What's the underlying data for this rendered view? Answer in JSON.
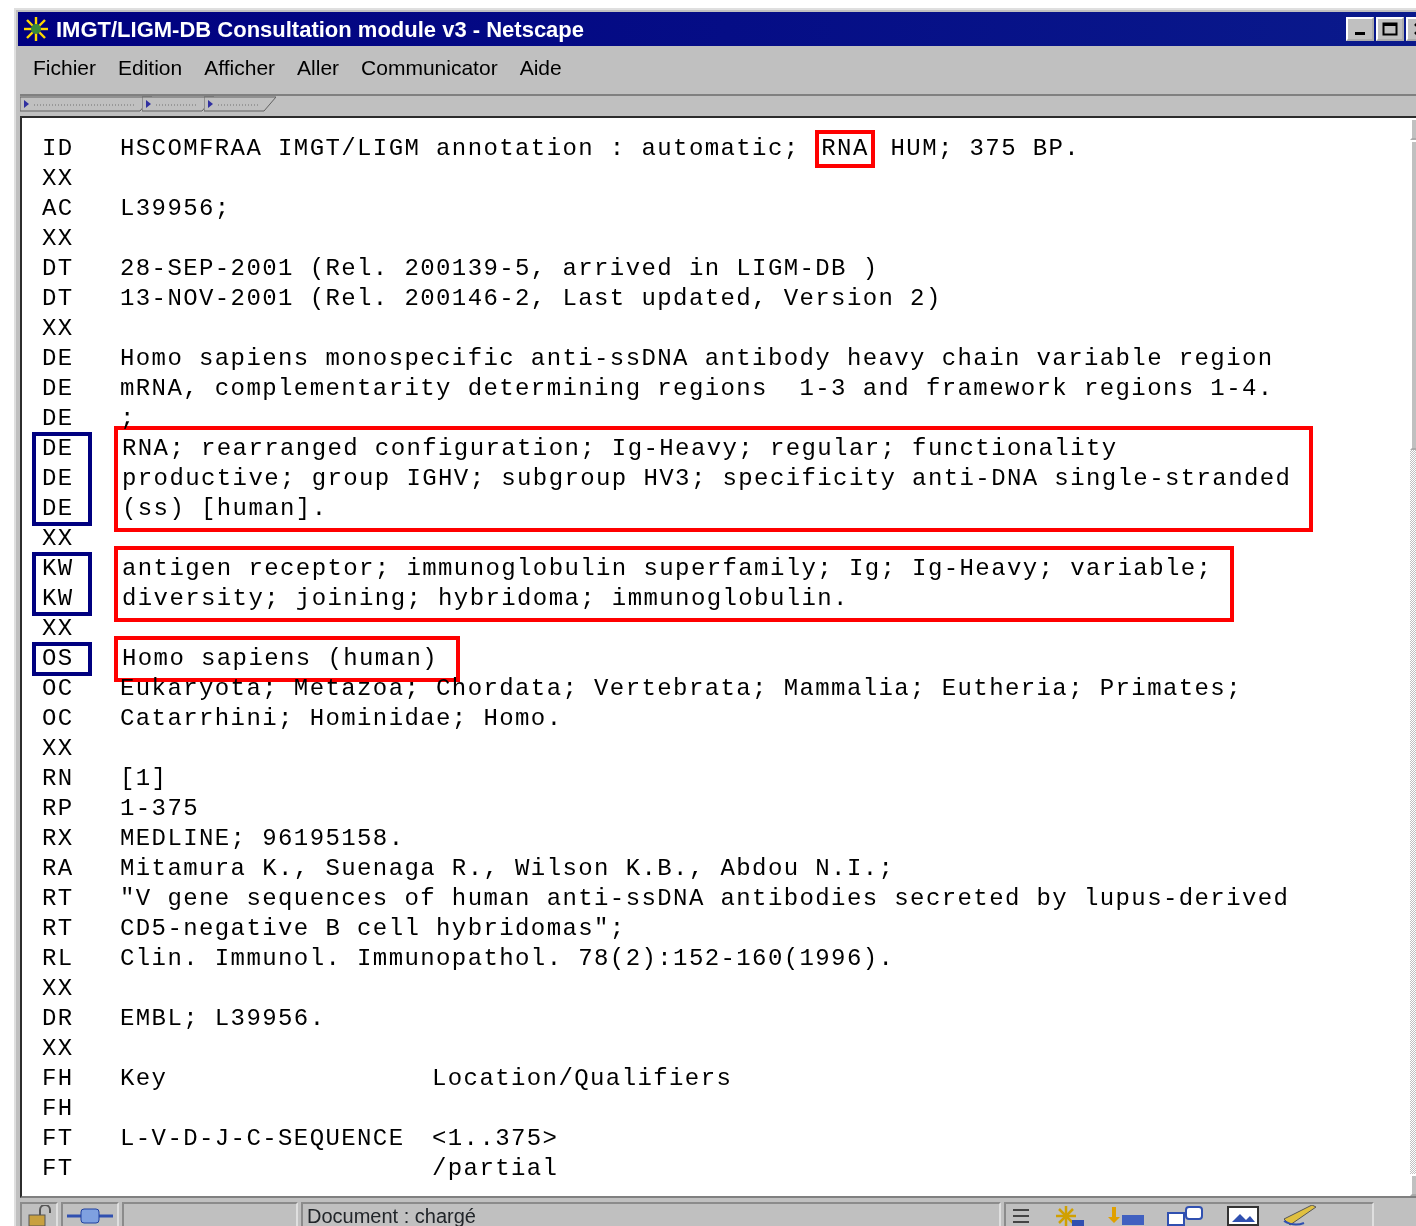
{
  "window": {
    "title": "IMGT/LIGM-DB Consultation module v3 - Netscape"
  },
  "menu": [
    {
      "label": "Fichier"
    },
    {
      "label": "Edition"
    },
    {
      "label": "Afficher"
    },
    {
      "label": "Aller"
    },
    {
      "label": "Communicator"
    },
    {
      "label": "Aide"
    }
  ],
  "blocks": [
    {
      "highlighted": false,
      "lines": [
        {
          "tag": "ID",
          "text": "HSCOMFRAA IMGT/LIGM annotation : automatic; ",
          "boxed": "RNA",
          "after": " HUM; 375 BP."
        },
        {
          "tag": "XX"
        },
        {
          "tag": "AC",
          "text": "L39956;"
        },
        {
          "tag": "XX"
        },
        {
          "tag": "DT",
          "text": "28-SEP-2001 (Rel. 200139-5, arrived in LIGM-DB )"
        },
        {
          "tag": "DT",
          "text": "13-NOV-2001 (Rel. 200146-2, Last updated, Version 2)"
        },
        {
          "tag": "XX"
        },
        {
          "tag": "DE",
          "text": "Homo sapiens monospecific anti-ssDNA antibody heavy chain variable region"
        },
        {
          "tag": "DE",
          "text": "mRNA, complementarity determining regions  1-3 and framework regions 1-4."
        },
        {
          "tag": "DE",
          "text": ";"
        }
      ]
    },
    {
      "highlighted": true,
      "lines": [
        {
          "tag": "DE",
          "text": "RNA; rearranged configuration; Ig-Heavy; regular; functionality"
        },
        {
          "tag": "DE",
          "text": "productive; group IGHV; subgroup HV3; specificity anti-DNA single-stranded"
        },
        {
          "tag": "DE",
          "text": "(ss) [human]."
        }
      ]
    },
    {
      "highlighted": false,
      "lines": [
        {
          "tag": "XX"
        }
      ]
    },
    {
      "highlighted": true,
      "lines": [
        {
          "tag": "KW",
          "text": "antigen receptor; immunoglobulin superfamily; Ig; Ig-Heavy; variable;"
        },
        {
          "tag": "KW",
          "text": "diversity; joining; hybridoma; immunoglobulin."
        }
      ]
    },
    {
      "highlighted": false,
      "lines": [
        {
          "tag": "XX"
        }
      ]
    },
    {
      "highlighted": true,
      "lines": [
        {
          "tag": "OS",
          "text": "Homo sapiens (human)"
        }
      ]
    },
    {
      "highlighted": false,
      "lines": [
        {
          "tag": "OC",
          "text": "Eukaryota; Metazoa; Chordata; Vertebrata; Mammalia; Eutheria; Primates;"
        },
        {
          "tag": "OC",
          "text": "Catarrhini; Hominidae; Homo."
        },
        {
          "tag": "XX"
        },
        {
          "tag": "RN",
          "text": "[1]"
        },
        {
          "tag": "RP",
          "text": "1-375"
        },
        {
          "tag": "RX",
          "text": "MEDLINE; 96195158."
        },
        {
          "tag": "RA",
          "text": "Mitamura K., Suenaga R., Wilson K.B., Abdou N.I.;"
        },
        {
          "tag": "RT",
          "text": "\"V gene sequences of human anti-ssDNA antibodies secreted by lupus-derived"
        },
        {
          "tag": "RT",
          "text": "CD5-negative B cell hybridomas\";"
        },
        {
          "tag": "RL",
          "text": "Clin. Immunol. Immunopathol. 78(2):152-160(1996)."
        },
        {
          "tag": "XX"
        },
        {
          "tag": "DR",
          "text": "EMBL; L39956."
        },
        {
          "tag": "XX"
        },
        {
          "tag": "FH",
          "text": "Key",
          "qualifier": "Location/Qualifiers"
        },
        {
          "tag": "FH"
        },
        {
          "tag": "FT",
          "text": "L-V-D-J-C-SEQUENCE",
          "qualifier": "<1..375>"
        },
        {
          "tag": "FT",
          "qualifier": "/partial"
        }
      ]
    }
  ],
  "status_bar": {
    "message": "Document : chargé"
  }
}
